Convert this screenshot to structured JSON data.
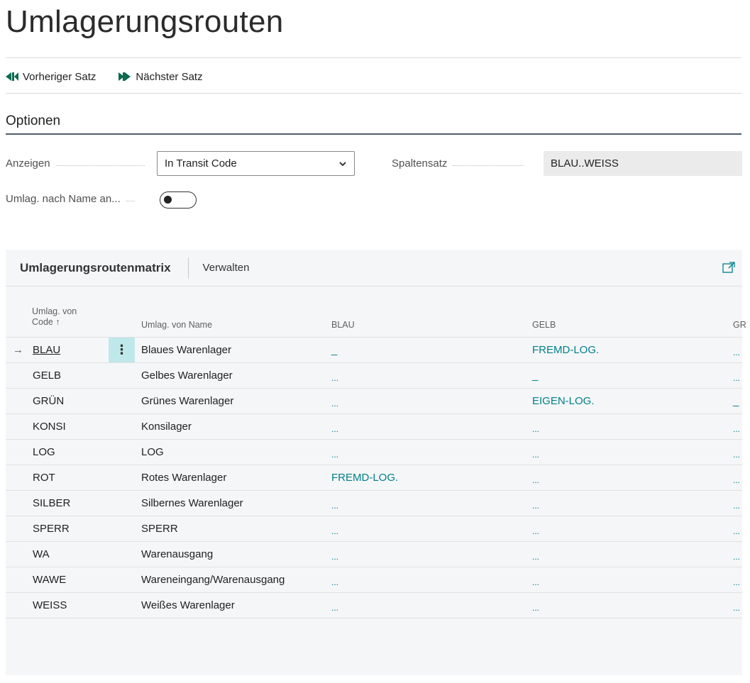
{
  "page": {
    "title": "Umlagerungsrouten"
  },
  "actions": {
    "prev": "Vorheriger Satz",
    "next": "Nächster Satz"
  },
  "options": {
    "section_title": "Optionen",
    "show_label": "Anzeigen",
    "show_value": "In Transit Code",
    "column_set_label": "Spaltensatz",
    "column_set_value": "BLAU..WEISS",
    "by_name_label": "Umlag. nach Name an...",
    "by_name_on": false
  },
  "matrix": {
    "title": "Umlagerungsroutenmatrix",
    "manage_label": "Verwalten",
    "columns": {
      "code_line1": "Umlag. von",
      "code_line2": "Code ↑",
      "name": "Umlag. von Name",
      "c1": "BLAU",
      "c2": "GELB",
      "c3": "GR"
    },
    "rows": [
      {
        "code": "BLAU",
        "name": "Blaues Warenlager",
        "c1": "_",
        "c2": "FREMD-LOG.",
        "c3": "..."
      },
      {
        "code": "GELB",
        "name": "Gelbes Warenlager",
        "c1": "...",
        "c2": "_",
        "c3": "..."
      },
      {
        "code": "GRÜN",
        "name": "Grünes Warenlager",
        "c1": "...",
        "c2": "EIGEN-LOG.",
        "c3": "_"
      },
      {
        "code": "KONSI",
        "name": "Konsilager",
        "c1": "...",
        "c2": "...",
        "c3": "..."
      },
      {
        "code": "LOG",
        "name": "LOG",
        "c1": "...",
        "c2": "...",
        "c3": "..."
      },
      {
        "code": "ROT",
        "name": "Rotes Warenlager",
        "c1": "FREMD-LOG.",
        "c2": "...",
        "c3": "..."
      },
      {
        "code": "SILBER",
        "name": "Silbernes Warenlager",
        "c1": "...",
        "c2": "...",
        "c3": "..."
      },
      {
        "code": "SPERR",
        "name": "SPERR",
        "c1": "...",
        "c2": "...",
        "c3": "..."
      },
      {
        "code": "WA",
        "name": "Warenausgang",
        "c1": "...",
        "c2": "...",
        "c3": "..."
      },
      {
        "code": "WAWE",
        "name": "Wareneingang/Warenausgang",
        "c1": "...",
        "c2": "...",
        "c3": "..."
      },
      {
        "code": "WEISS",
        "name": "Weißes Warenlager",
        "c1": "...",
        "c2": "...",
        "c3": "..."
      }
    ],
    "selected_row": 0,
    "selected_arrow": "→",
    "menu_glyph": "⋮"
  },
  "colors": {
    "accent": "#00808a",
    "selected_menu_bg": "#bfe8ea",
    "section_line": "#505c6d"
  }
}
